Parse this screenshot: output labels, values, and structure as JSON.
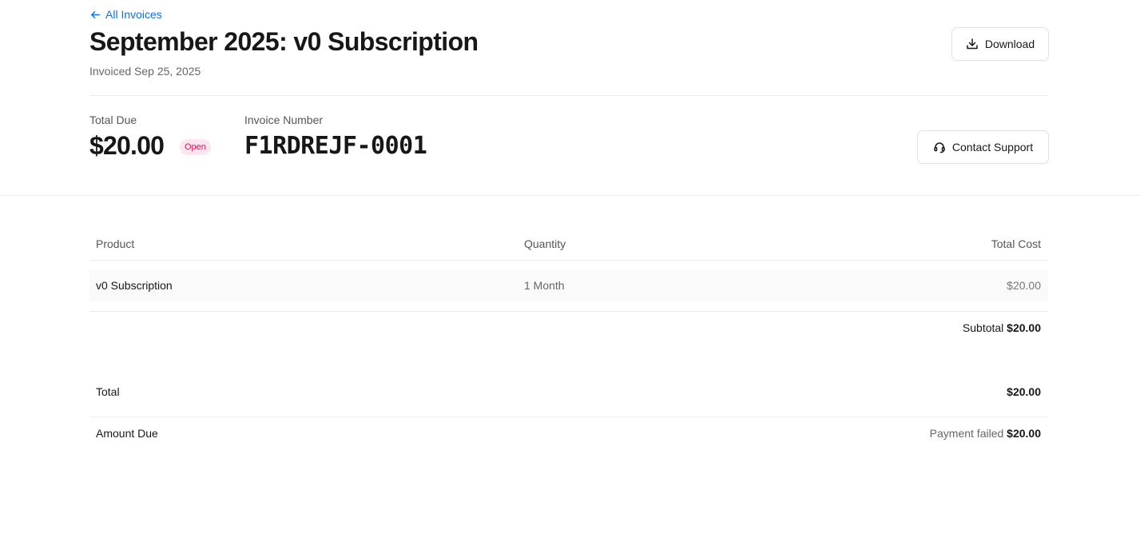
{
  "header": {
    "back_link": "All Invoices",
    "title": "September 2025: v0 Subscription",
    "subtitle": "Invoiced Sep 25, 2025",
    "download_label": "Download"
  },
  "summary": {
    "total_due_label": "Total Due",
    "total_due_value": "$20.00",
    "status_badge": "Open",
    "invoice_number_label": "Invoice Number",
    "invoice_number": "F1RDREJF-0001",
    "contact_support_label": "Contact Support"
  },
  "table": {
    "headers": [
      "Product",
      "Quantity",
      "Total Cost"
    ],
    "rows": [
      [
        "v0 Subscription",
        "1 Month",
        "$20.00"
      ]
    ],
    "subtotal_label": "Subtotal",
    "subtotal_value": "$20.00"
  },
  "totals": {
    "total_label": "Total",
    "total_value": "$20.00",
    "amount_due_label": "Amount Due",
    "amount_due_status": "Payment failed",
    "amount_due_value": "$20.00"
  },
  "colors": {
    "link": "#0a72ef",
    "badge_bg": "#fde6ef",
    "badge_text": "#c4215d"
  }
}
